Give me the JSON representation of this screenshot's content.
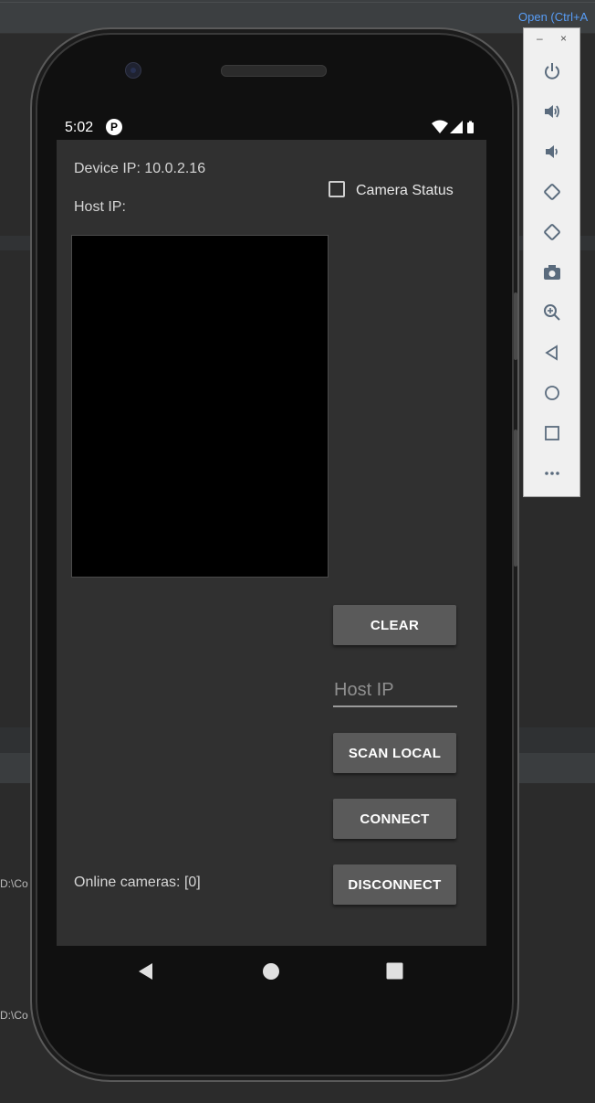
{
  "ide": {
    "open_hint": "Open (Ctrl+A",
    "path_text_1": "D:\\Co",
    "path_text_2": "D:\\Co"
  },
  "status_bar": {
    "time": "5:02"
  },
  "app": {
    "device_ip_label": "Device IP: 10.0.2.16",
    "host_ip_label": "Host IP:",
    "camera_status_label": "Camera Status",
    "camera_status_checked": false,
    "clear_button": "CLEAR",
    "host_ip_placeholder": "Host IP",
    "host_ip_value": "",
    "scan_local_button": "SCAN LOCAL",
    "connect_button": "CONNECT",
    "disconnect_button": "DISCONNECT",
    "online_cameras_label": "Online cameras: [0]"
  },
  "colors": {
    "screen_bg": "#303030",
    "button_bg": "#5a5a5a",
    "preview_bg": "#000000",
    "link_blue": "#589df6"
  },
  "emulator_toolbar": {
    "minimize": "–",
    "close": "×",
    "icons": [
      "power-icon",
      "volume-up-icon",
      "volume-down-icon",
      "rotate-left-icon",
      "rotate-right-icon",
      "camera-icon",
      "zoom-icon",
      "back-icon",
      "home-icon",
      "overview-icon",
      "more-icon"
    ]
  }
}
